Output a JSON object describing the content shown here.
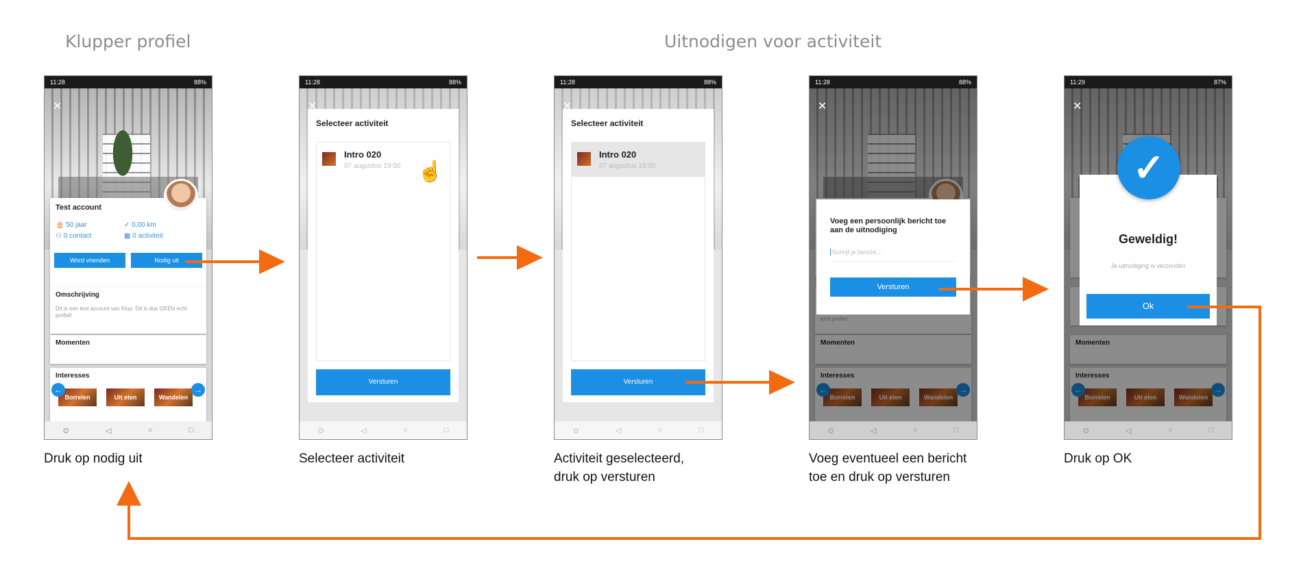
{
  "sections": {
    "left_title": "Klupper profiel",
    "right_title": "Uitnodigen voor activiteit"
  },
  "status": {
    "time_a": "11:28",
    "time_b": "11:29",
    "battery_a": "88%",
    "battery_b": "87%"
  },
  "profile": {
    "name": "Test account",
    "age": "50 jaar",
    "distance": "0,00 km",
    "contacts": "0 contact",
    "activities": "0 activiteit",
    "btn_friends": "Word vrienden",
    "btn_invite": "Nodig uit",
    "description_title": "Omschrijving",
    "description_text": "Dit is een test account van Klup. Dit is dus GEEN echt profiel!",
    "description_tail": "echt profiel",
    "moments_title": "Momenten",
    "interests_title": "Interesses",
    "interests": [
      "Borrelen",
      "Uit eten",
      "Wandelen"
    ]
  },
  "select": {
    "title": "Selecteer activiteit",
    "activity_name": "Intro 020",
    "activity_date": "07 augustus 19:00",
    "send_label": "Versturen"
  },
  "message": {
    "title": "Voeg een persoonlijk bericht toe aan de uitnodiging",
    "placeholder": "Schrijf je bericht...",
    "send_label": "Versturen"
  },
  "success": {
    "title": "Geweldig!",
    "subtitle": "Je uitnodiging is verzonden",
    "ok_label": "Ok"
  },
  "captions": {
    "step1": "Druk op nodig uit",
    "step2": "Selecteer activiteit",
    "step3_line1": "Activiteit geselecteerd,",
    "step3_line2": "druk op versturen",
    "step4_line1": "Voeg eventueel een bericht",
    "step4_line2": "toe en druk op versturen",
    "step5": "Druk op OK"
  },
  "colors": {
    "arrow": "#f26b10",
    "accent_blue": "#1a8fe3",
    "title_gray": "#8c8c8c"
  }
}
